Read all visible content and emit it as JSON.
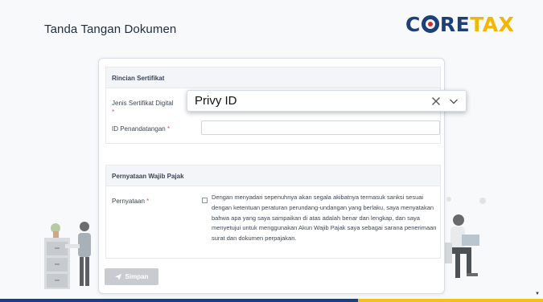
{
  "header": {
    "title": "Tanda Tangan Dokumen",
    "logo_part1": "C",
    "logo_part2": "RE",
    "logo_part3": "TAX"
  },
  "certificate_section": {
    "title": "Rincian Sertifikat",
    "type_label": "Jenis Sertifikat Digital",
    "type_required": "*",
    "type_value": "Privy ID",
    "signer_id_label": "ID Penandatangan",
    "signer_id_required": "*",
    "signer_id_value": ""
  },
  "statement_section": {
    "title": "Pernyataan Wajib Pajak",
    "label": "Pernyataan",
    "required": "*",
    "checked": false,
    "text": "Dengan menyadari sepenuhnya akan segala akibatnya termasuk sanksi sesuai dengan ketentuan peraturan perundang-undangan yang berlaku, saya menyatakan bahwa apa yang saya sampaikan di atas adalah benar dan lengkap, dan saya menyetujui untuk menggunakan Akun Wajib Pajak saya sebagai sarana penerimaan surat dan dokumen perpajakan."
  },
  "actions": {
    "save_label": "Simpan"
  },
  "colors": {
    "brand_navy": "#1d3f7a",
    "brand_gold": "#f2b705",
    "required_red": "#d9534f",
    "disabled_button": "#c8ccd1"
  },
  "icons": {
    "clear": "close-icon",
    "dropdown": "chevron-down-icon",
    "save": "send-icon"
  }
}
